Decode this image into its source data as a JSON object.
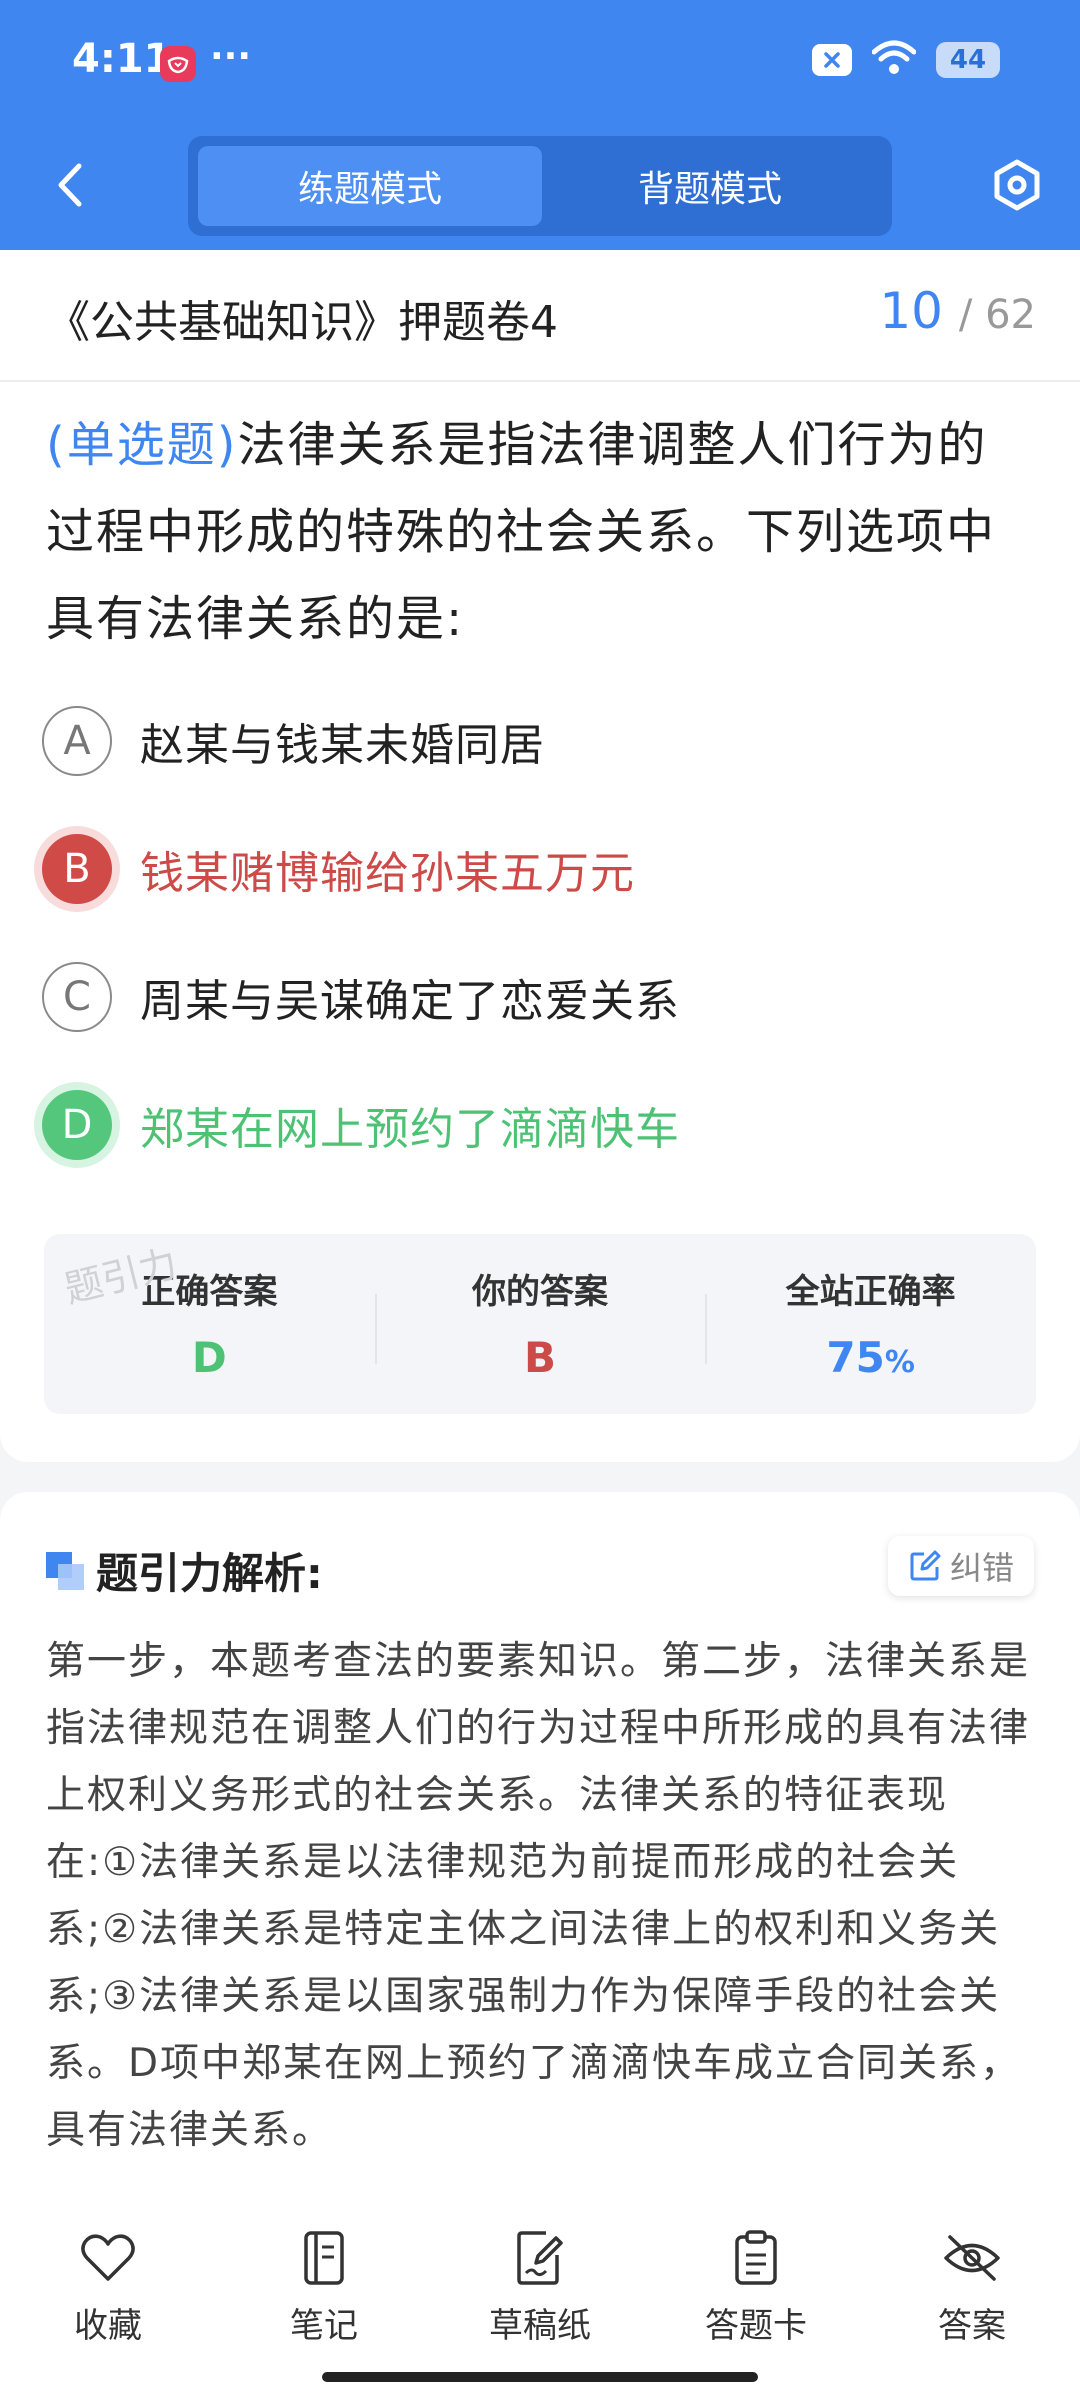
{
  "status_bar": {
    "time": "4:11",
    "more": "···",
    "battery": "44"
  },
  "header": {
    "tabs": [
      {
        "label": "练题模式",
        "active": true
      },
      {
        "label": "背题模式",
        "active": false
      }
    ]
  },
  "paper": {
    "title": "《公共基础知识》押题卷4",
    "current": "10",
    "total": "/ 62"
  },
  "question": {
    "type": "(单选题)",
    "text": "法律关系是指法律调整人们行为的过程中形成的特殊的社会关系。下列选项中具有法律关系的是:"
  },
  "options": [
    {
      "letter": "A",
      "text": "赵某与钱某未婚同居",
      "state": "normal"
    },
    {
      "letter": "B",
      "text": "钱某赌博输给孙某五万元",
      "state": "wrong"
    },
    {
      "letter": "C",
      "text": "周某与吴谋确定了恋爱关系",
      "state": "normal"
    },
    {
      "letter": "D",
      "text": "郑某在网上预约了滴滴快车",
      "state": "correct"
    }
  ],
  "result": {
    "correct_label": "正确答案",
    "correct_value": "D",
    "yours_label": "你的答案",
    "yours_value": "B",
    "rate_label": "全站正确率",
    "rate_value": "75",
    "rate_unit": "%",
    "watermark": "题引力"
  },
  "analysis": {
    "title": "题引力解析:",
    "report_label": "纠错",
    "body": "第一步，本题考查法的要素知识。第二步，法律关系是指法律规范在调整人们的行为过程中所形成的具有法律上权利义务形式的社会关系。法律关系的特征表现在:①法律关系是以法律规范为前提而形成的社会关系;②法律关系是特定主体之间法律上的权利和义务关系;③法律关系是以国家强制力作为保障手段的社会关系。D项中郑某在网上预约了滴滴快车成立合同关系，具有法律关系。"
  },
  "toolbar": {
    "items": [
      {
        "label": "收藏",
        "icon": "heart-icon"
      },
      {
        "label": "笔记",
        "icon": "notebook-icon"
      },
      {
        "label": "草稿纸",
        "icon": "draft-icon"
      },
      {
        "label": "答题卡",
        "icon": "clipboard-icon"
      },
      {
        "label": "答案",
        "icon": "eye-off-icon"
      }
    ]
  },
  "colors": {
    "primary": "#3f86f0",
    "correct": "#4ec274",
    "wrong": "#cc4a47"
  }
}
